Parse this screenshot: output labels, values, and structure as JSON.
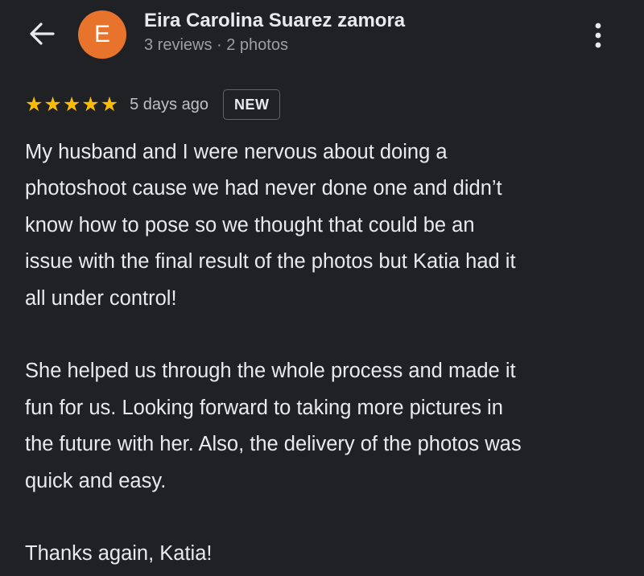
{
  "header": {
    "avatar_letter": "E",
    "avatar_color": "#e8732c",
    "reviewer_name": "Eira Carolina Suarez zamora",
    "reviewer_meta": "3 reviews · 2 photos",
    "back_icon": "arrow-back-icon",
    "more_icon": "more-vert-icon"
  },
  "review": {
    "rating": 5,
    "rating_max": 5,
    "star_color": "#fbbc04",
    "star_glyph": "★",
    "time_ago": "5 days ago",
    "badge": "NEW",
    "lines": [
      "My husband and I were nervous about doing a",
      "photoshoot cause we had never done one and didn’t",
      "know how to pose so we thought that could be an",
      "issue with the final result of the photos but Katia had it",
      "all under control!",
      "",
      "She helped us through the whole process and made it",
      "fun for us. Looking forward to taking more pictures in",
      "the future with her. Also, the delivery of the photos was",
      "quick and easy.",
      "",
      "Thanks again, Katia!"
    ]
  }
}
